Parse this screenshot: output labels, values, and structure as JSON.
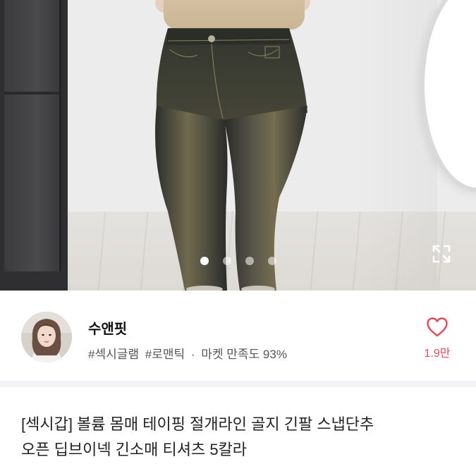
{
  "carousel": {
    "image_alt": "product-photo-jeans",
    "page_count": 4,
    "active_index": 0
  },
  "icons": {
    "expand": "expand-icon",
    "heart": "heart-icon"
  },
  "shop": {
    "name": "수앤핏",
    "tags": [
      "#섹시글램",
      "#로맨틱"
    ],
    "separator": "·",
    "satisfaction": "마켓 만족도 93%",
    "likes": "1.9만"
  },
  "product": {
    "title_line1": "[섹시갑] 볼륨 몸매 테이핑 절개라인 골지 긴팔 스냅단추",
    "title_line2": "오픈 딥브이넥 긴소매 티셔츠 5칼라"
  },
  "colors": {
    "accent": "#e0495b",
    "text": "#111111",
    "subtext": "#555555",
    "divider": "#f4f4f6"
  }
}
